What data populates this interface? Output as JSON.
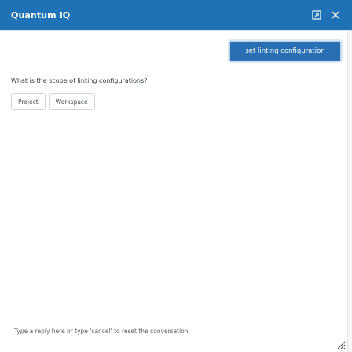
{
  "window": {
    "title": "Quantum IQ",
    "restore_icon": "restore-icon",
    "close_icon": "close-icon",
    "accent_color": "#1e72b5"
  },
  "header": {
    "action_label": "set linting configuration"
  },
  "conversation": {
    "question": "What is the scope of linting configurations?",
    "options": [
      "Project",
      "Workspace"
    ]
  },
  "input": {
    "placeholder": "Type a reply here or type 'cancel' to reset the conversation"
  }
}
